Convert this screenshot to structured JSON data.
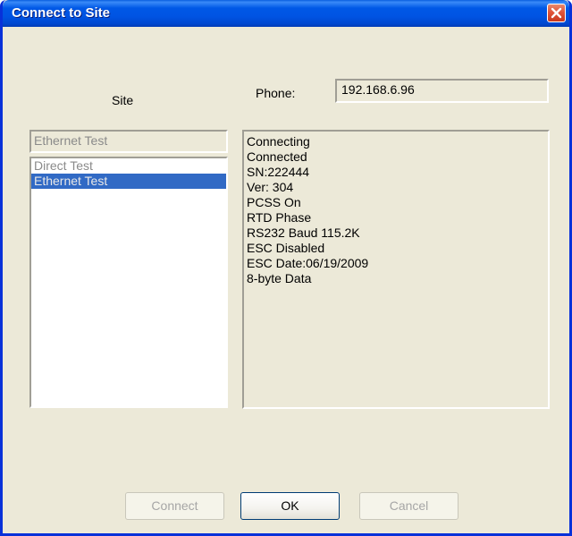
{
  "window": {
    "title": "Connect to Site"
  },
  "labels": {
    "site": "Site",
    "phone": "Phone:"
  },
  "phone_value": "192.168.6.96",
  "site_combo_value": "Ethernet Test",
  "site_list": {
    "items": [
      "Direct Test",
      "Ethernet Test"
    ],
    "selected": "Ethernet Test"
  },
  "status_lines": [
    "Connecting",
    "Connected",
    "SN:222444",
    "Ver: 304",
    "PCSS On",
    "RTD Phase",
    "RS232 Baud 115.2K",
    "ESC Disabled",
    "ESC Date:06/19/2009",
    "8-byte Data"
  ],
  "buttons": {
    "connect": "Connect",
    "ok": "OK",
    "cancel": "Cancel"
  },
  "colors": {
    "title_bar": "#0054E3",
    "dialog_bg": "#ECE9D8",
    "selection": "#316AC5",
    "close_button": "#E0553A"
  },
  "icons": {
    "close": "close-icon"
  }
}
